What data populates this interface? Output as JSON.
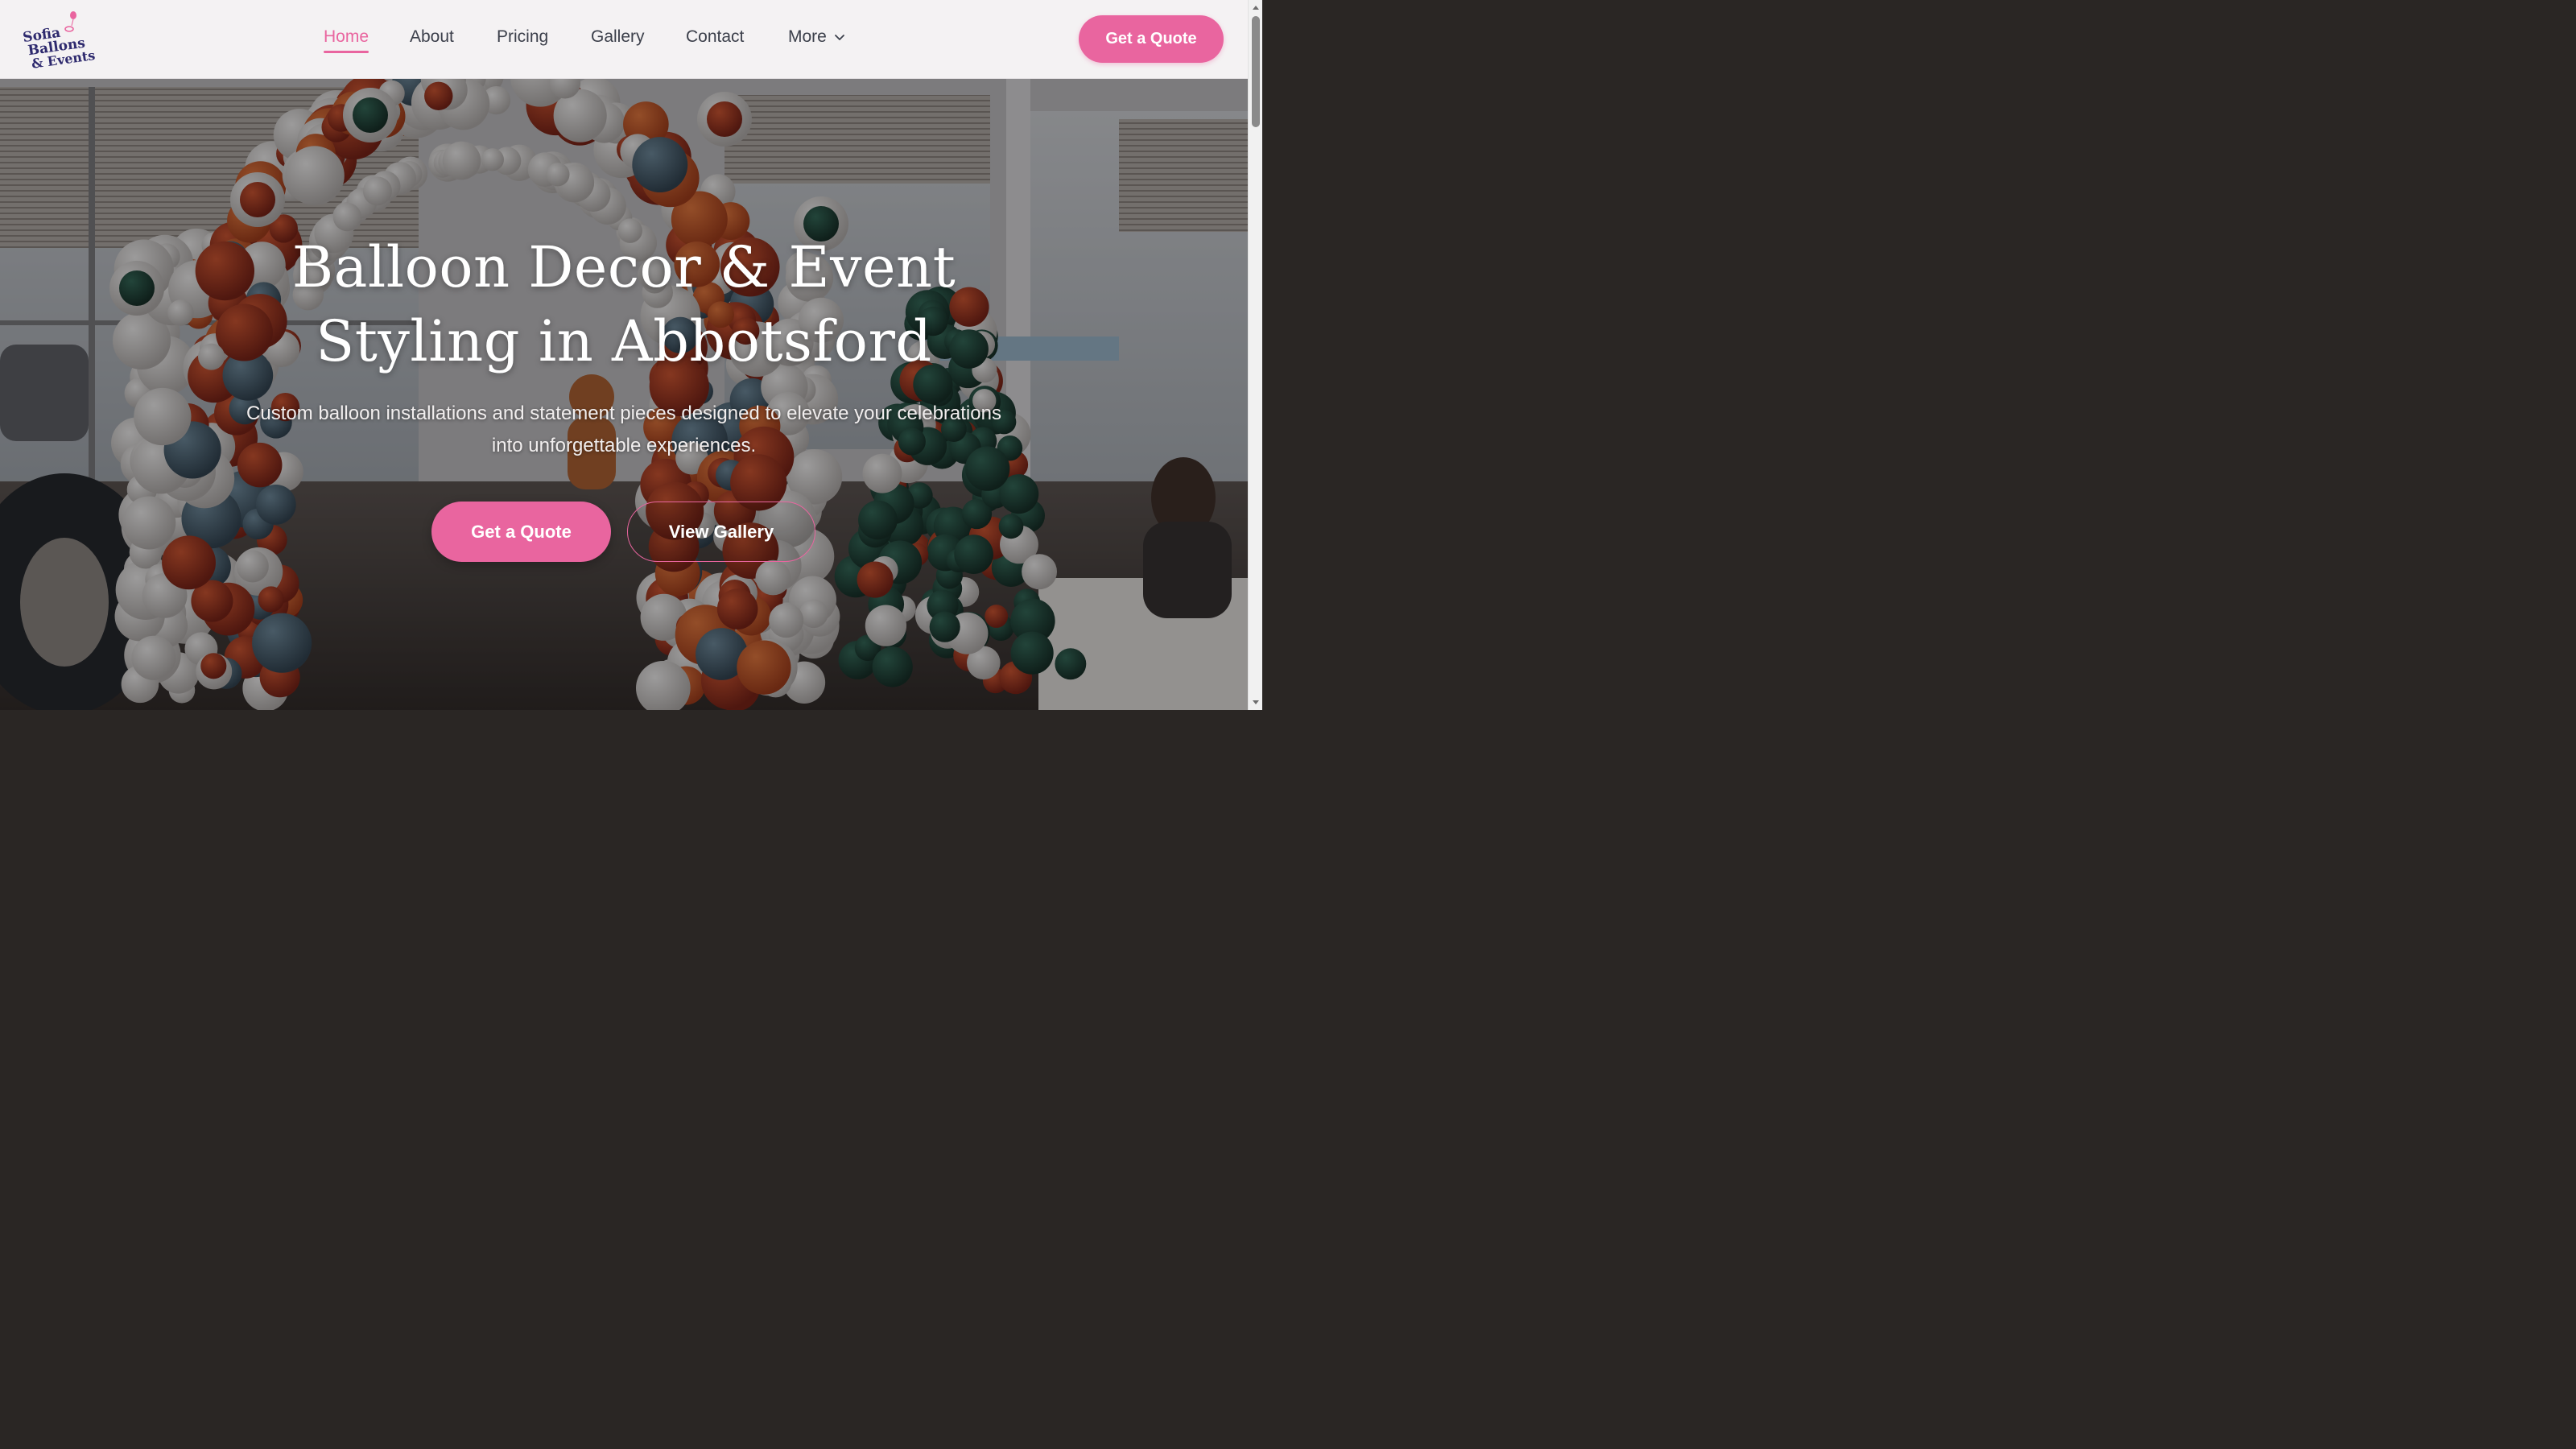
{
  "brand": {
    "logo_lines": [
      "Sofia",
      "Ballons",
      "& Events"
    ]
  },
  "nav": {
    "items": [
      {
        "label": "Home",
        "active": true
      },
      {
        "label": "About",
        "active": false
      },
      {
        "label": "Pricing",
        "active": false
      },
      {
        "label": "Gallery",
        "active": false
      },
      {
        "label": "Contact",
        "active": false
      }
    ],
    "more_label": "More",
    "more_icon": "chevron-down-icon"
  },
  "header": {
    "cta_label": "Get a Quote"
  },
  "hero": {
    "title_line1": "Balloon Decor & Event",
    "title_line2": "Styling in Abbotsford",
    "subtitle": "Custom balloon installations and statement pieces designed to elevate your celebrations into unforgettable experiences.",
    "primary_button": "Get a Quote",
    "secondary_button": "View Gallery",
    "background_image": "balloon-arch-holiday-photo"
  },
  "colors": {
    "accent": "#e9659f",
    "nav_text": "#3b3f4a",
    "header_bg": "#f4f2f3",
    "logo_ink": "#2e2a6e"
  }
}
